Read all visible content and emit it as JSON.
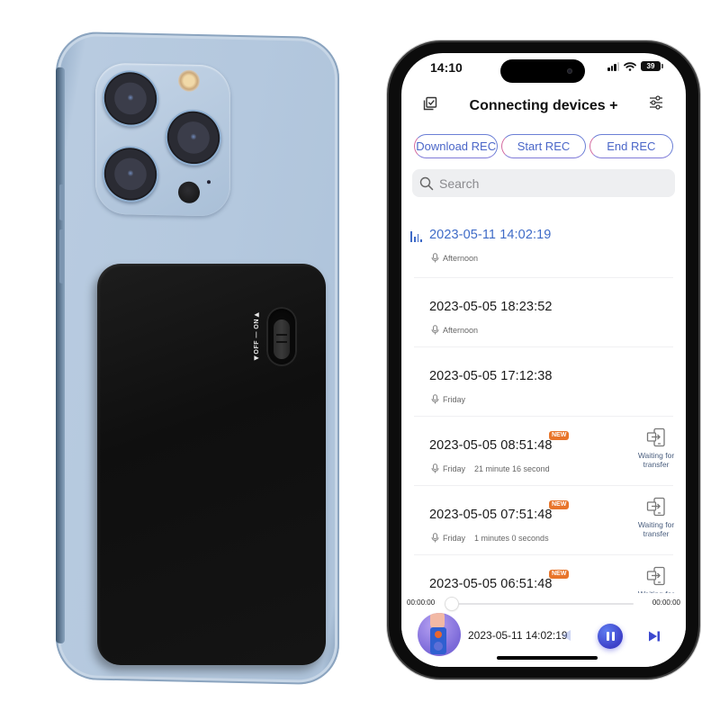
{
  "device_photo": {
    "power_bank_switch": {
      "label_on": "ON",
      "label_off": "OFF",
      "label_text": "◀OFF — ON▶"
    }
  },
  "status_bar": {
    "time": "14:10",
    "battery": "39"
  },
  "header": {
    "title": "Connecting devices +",
    "left_icon": "select-checkbox-icon",
    "right_icon": "sliders-filter-icon"
  },
  "rec_buttons": [
    {
      "label": "Download REC"
    },
    {
      "label": "Start REC"
    },
    {
      "label": "End REC"
    }
  ],
  "search": {
    "placeholder": "Search",
    "value": ""
  },
  "recordings": [
    {
      "title": "2023-05-11 14:02:19",
      "tag": "Afternoon",
      "duration": "",
      "is_new": false,
      "active": true,
      "status": ""
    },
    {
      "title": "2023-05-05 18:23:52",
      "tag": "Afternoon",
      "duration": "",
      "is_new": false,
      "active": false,
      "status": ""
    },
    {
      "title": "2023-05-05 17:12:38",
      "tag": "Friday",
      "duration": "",
      "is_new": false,
      "active": false,
      "status": ""
    },
    {
      "title": "2023-05-05 08:51:48",
      "tag": "Friday",
      "duration": "21 minute 16 second",
      "is_new": true,
      "active": false,
      "status": "Waiting for transfer"
    },
    {
      "title": "2023-05-05 07:51:48",
      "tag": "Friday",
      "duration": "1 minutes 0 seconds",
      "is_new": true,
      "active": false,
      "status": "Waiting for transfer"
    },
    {
      "title": "2023-05-05 06:51:48",
      "tag": "",
      "duration": "",
      "is_new": true,
      "active": false,
      "status": "Waiting for"
    }
  ],
  "new_badge_label": "NEW",
  "player": {
    "time_elapsed": "00:00:00",
    "time_total": "00:00:00",
    "progress_fraction": 0,
    "now_playing": "2023-05-11 14:02:19",
    "state": "playing"
  },
  "colors": {
    "accent_blue": "#3f6bc7",
    "new_badge": "#e8752b",
    "phone_back": "#b4c8de",
    "power_bank": "#141414"
  }
}
